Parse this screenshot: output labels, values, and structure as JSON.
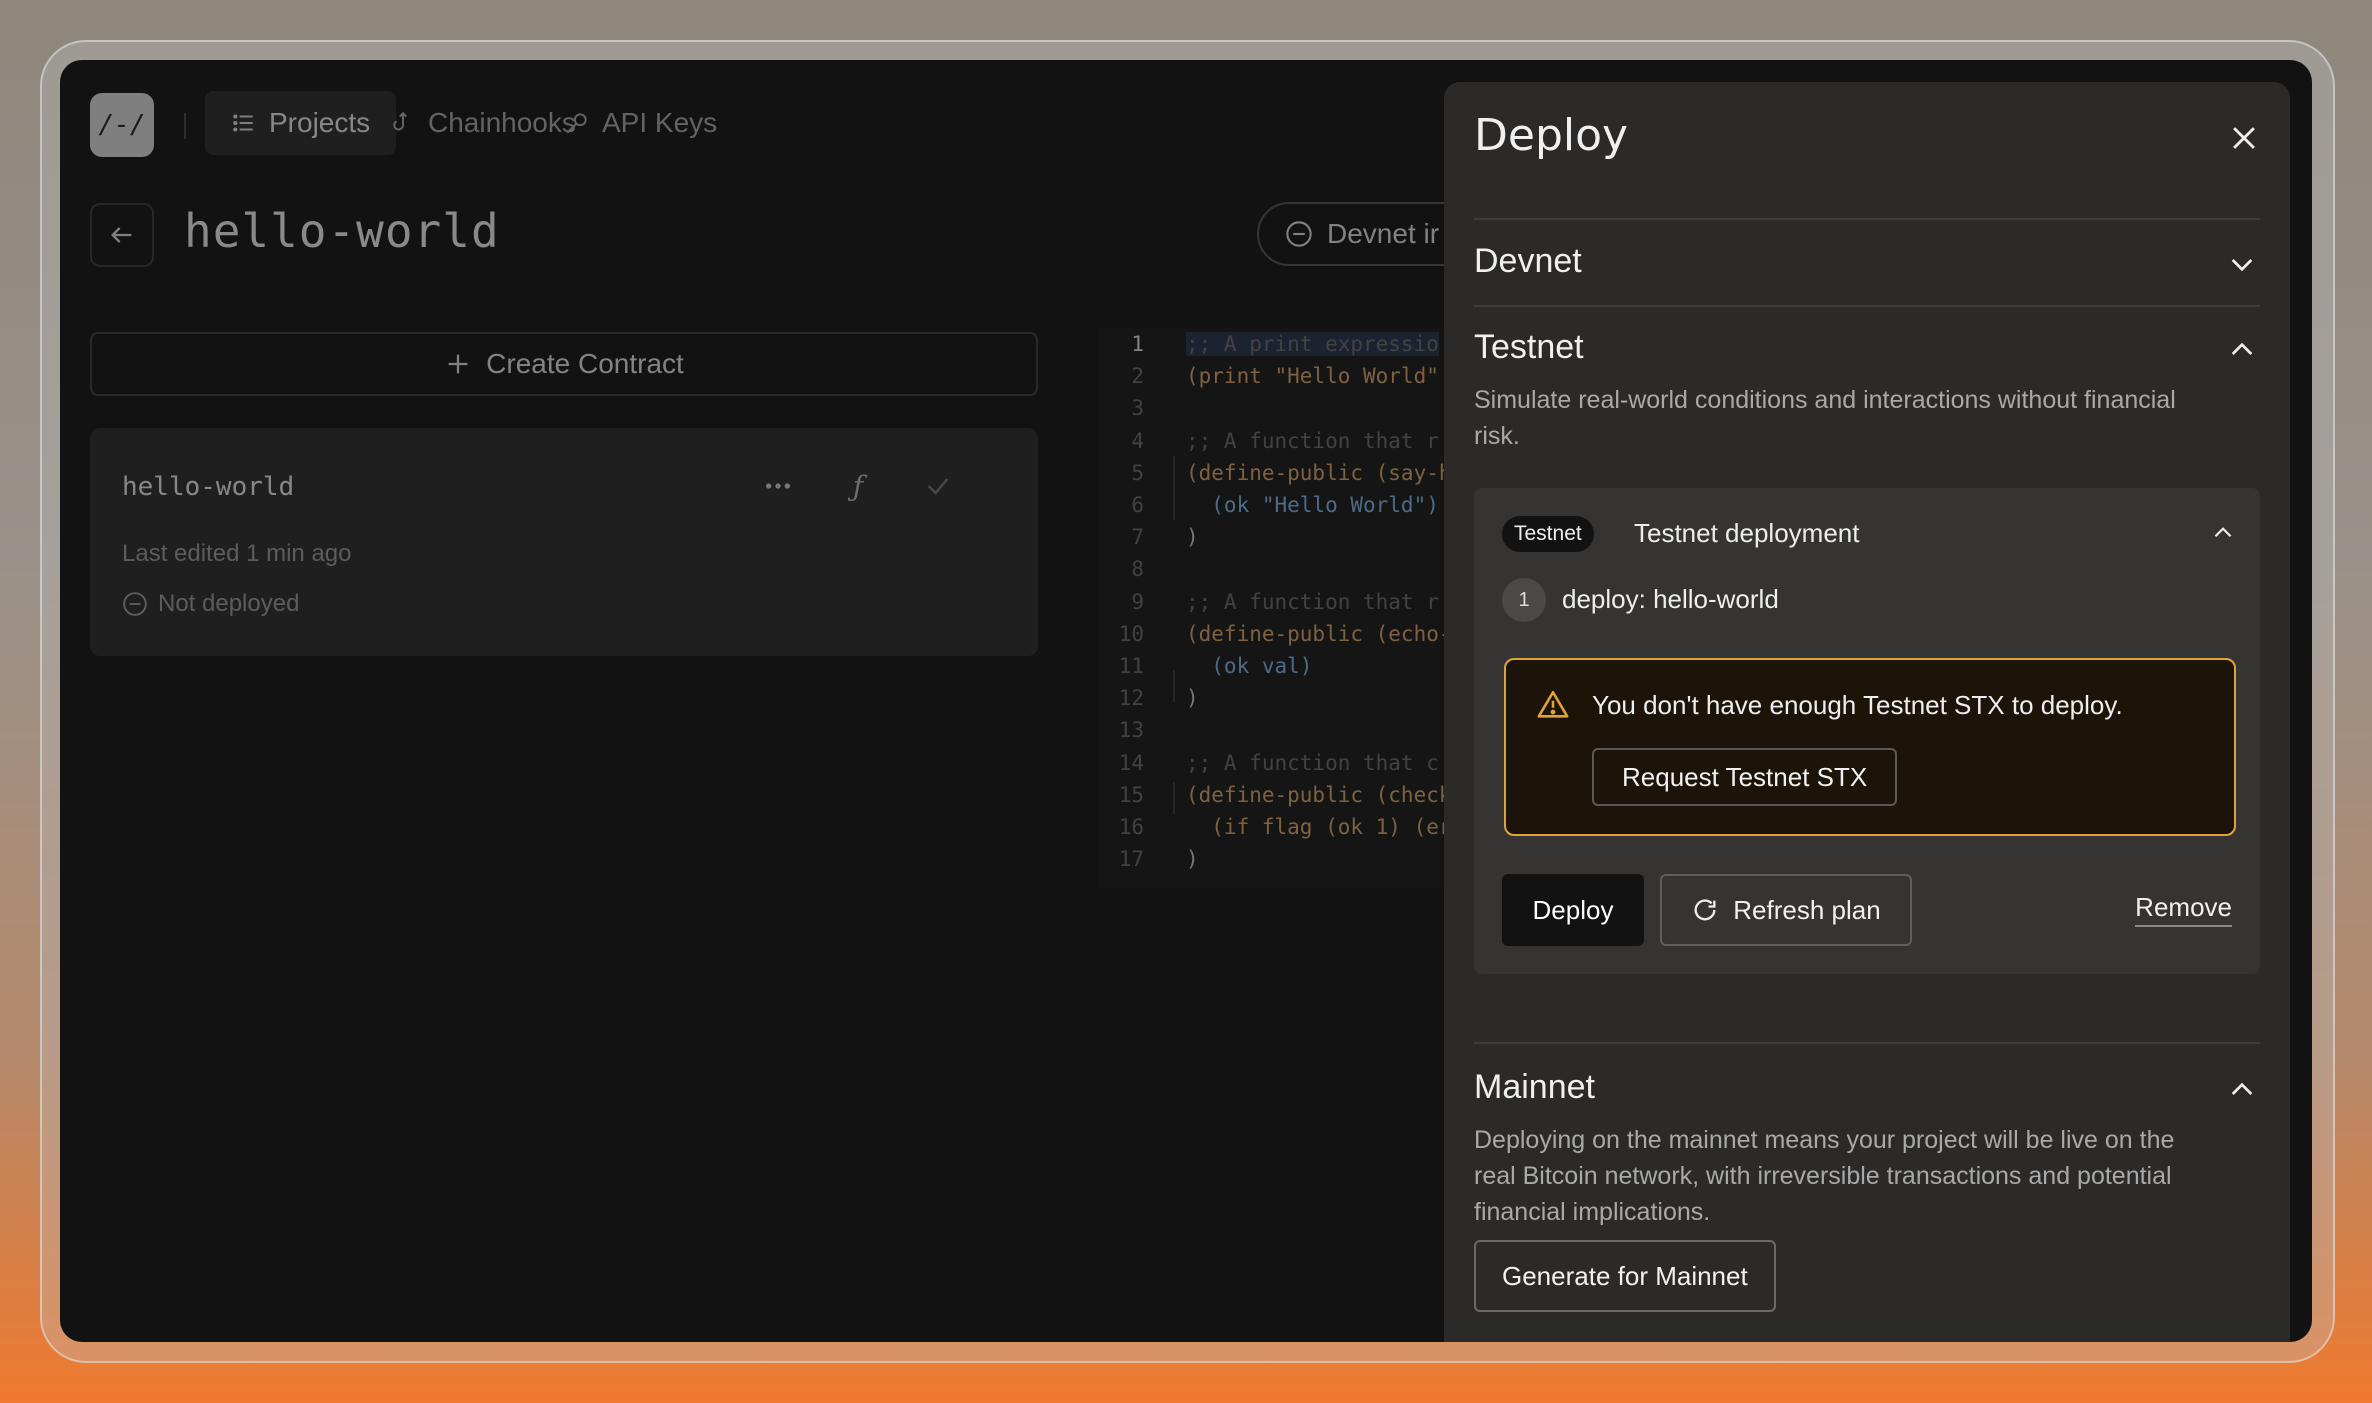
{
  "nav": {
    "logo_text": "/-/",
    "items": [
      {
        "label": "Projects",
        "icon": "list-icon",
        "active": true
      },
      {
        "label": "Chainhooks",
        "icon": "hook-icon",
        "active": false
      },
      {
        "label": "API Keys",
        "icon": "key-icon",
        "active": false
      }
    ]
  },
  "project": {
    "title": "hello-world",
    "network_pill": "Devnet ir"
  },
  "sidebar": {
    "create_label": "Create Contract",
    "contract": {
      "name": "hello-world",
      "edited": "Last edited 1 min ago",
      "status": "Not deployed"
    }
  },
  "editor": {
    "lines": [
      {
        "n": "1",
        "text": ";; A print expressio"
      },
      {
        "n": "2",
        "text": "(print \"Hello World\""
      },
      {
        "n": "3",
        "text": ""
      },
      {
        "n": "4",
        "text": ";; A function that r"
      },
      {
        "n": "5",
        "text": "(define-public (say-h"
      },
      {
        "n": "6",
        "text": "  (ok \"Hello World\")"
      },
      {
        "n": "7",
        "text": ")"
      },
      {
        "n": "8",
        "text": ""
      },
      {
        "n": "9",
        "text": ";; A function that r"
      },
      {
        "n": "10",
        "text": "(define-public (echo-"
      },
      {
        "n": "11",
        "text": "  (ok val)"
      },
      {
        "n": "12",
        "text": ")"
      },
      {
        "n": "13",
        "text": ""
      },
      {
        "n": "14",
        "text": ";; A function that c"
      },
      {
        "n": "15",
        "text": "(define-public (check"
      },
      {
        "n": "16",
        "text": "  (if flag (ok 1) (er"
      },
      {
        "n": "17",
        "text": ")"
      }
    ]
  },
  "panel": {
    "title": "Deploy",
    "devnet": {
      "title": "Devnet"
    },
    "testnet": {
      "title": "Testnet",
      "description": "Simulate real-world conditions and interactions without financial risk.",
      "tag": "Testnet",
      "deployment_title": "Testnet deployment",
      "step_number": "1",
      "step_text": "deploy: hello-world",
      "warning": "You don't have enough Testnet STX to deploy.",
      "request_label": "Request Testnet STX",
      "deploy_label": "Deploy",
      "refresh_label": "Refresh plan",
      "remove_label": "Remove"
    },
    "mainnet": {
      "title": "Mainnet",
      "description": "Deploying on the mainnet means your project will be live on the real Bitcoin network, with irreversible transactions and potential financial implications.",
      "generate_label": "Generate for Mainnet"
    }
  },
  "colors": {
    "warning_border": "#e2a23a",
    "panel_bg": "#2b2a29",
    "app_bg": "#121212"
  }
}
